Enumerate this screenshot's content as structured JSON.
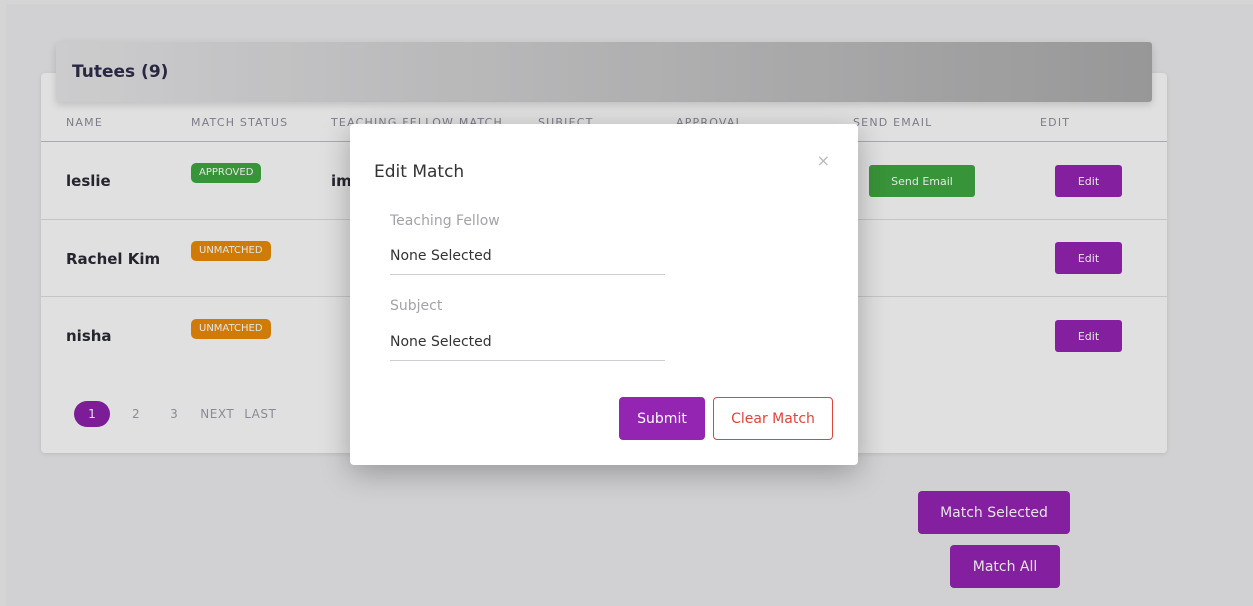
{
  "card": {
    "title": "Tutees (9)"
  },
  "columns": [
    "NAME",
    "MATCH STATUS",
    "TEACHING FELLOW MATCH",
    "SUBJECT",
    "APPROVAL",
    "SEND EMAIL",
    "EDIT"
  ],
  "rows": [
    {
      "name": "leslie",
      "status": "APPROVED",
      "fellow_partial": "im",
      "send_email": "Send Email",
      "edit": "Edit"
    },
    {
      "name": "Rachel Kim",
      "status": "UNMATCHED",
      "edit": "Edit"
    },
    {
      "name": "nisha",
      "status": "UNMATCHED",
      "edit": "Edit"
    }
  ],
  "pagination": {
    "active": "1",
    "pages": [
      "2",
      "3"
    ],
    "next": "NEXT",
    "last": "LAST"
  },
  "actions": {
    "match_selected": "Match Selected",
    "match_all": "Match All"
  },
  "modal": {
    "title": "Edit Match",
    "close": "×",
    "teaching_fellow_label": "Teaching Fellow",
    "teaching_fellow_value": "None Selected",
    "subject_label": "Subject",
    "subject_value": "None Selected",
    "submit": "Submit",
    "clear": "Clear Match"
  },
  "colors": {
    "accent": "#9424b2",
    "approved": "#3fa53f",
    "unmatched": "#e88a0a",
    "danger": "#e0453a"
  }
}
